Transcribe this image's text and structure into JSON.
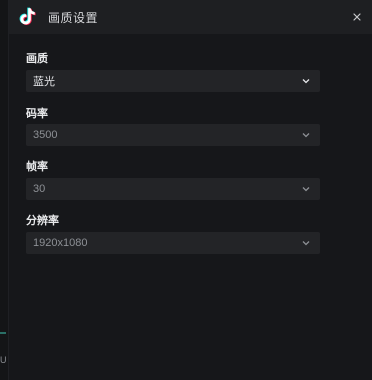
{
  "dialog": {
    "title": "画质设置",
    "close_glyph": "×",
    "logo_icon": "tiktok-logo-icon"
  },
  "fields": [
    {
      "label": "画质",
      "value": "蓝光"
    },
    {
      "label": "码率",
      "value": "3500"
    },
    {
      "label": "帧率",
      "value": "30"
    },
    {
      "label": "分辨率",
      "value": "1920x1080"
    }
  ],
  "background_window": {
    "edge_text": "U"
  },
  "colors": {
    "dialog_bg": "#16171a",
    "titlebar_bg": "#1e1f22",
    "select_bg": "#232427",
    "label_text": "#e8e9eb",
    "value_text": "#8d9095",
    "logo_cyan": "#25f4ee",
    "logo_red": "#fe2c55"
  }
}
